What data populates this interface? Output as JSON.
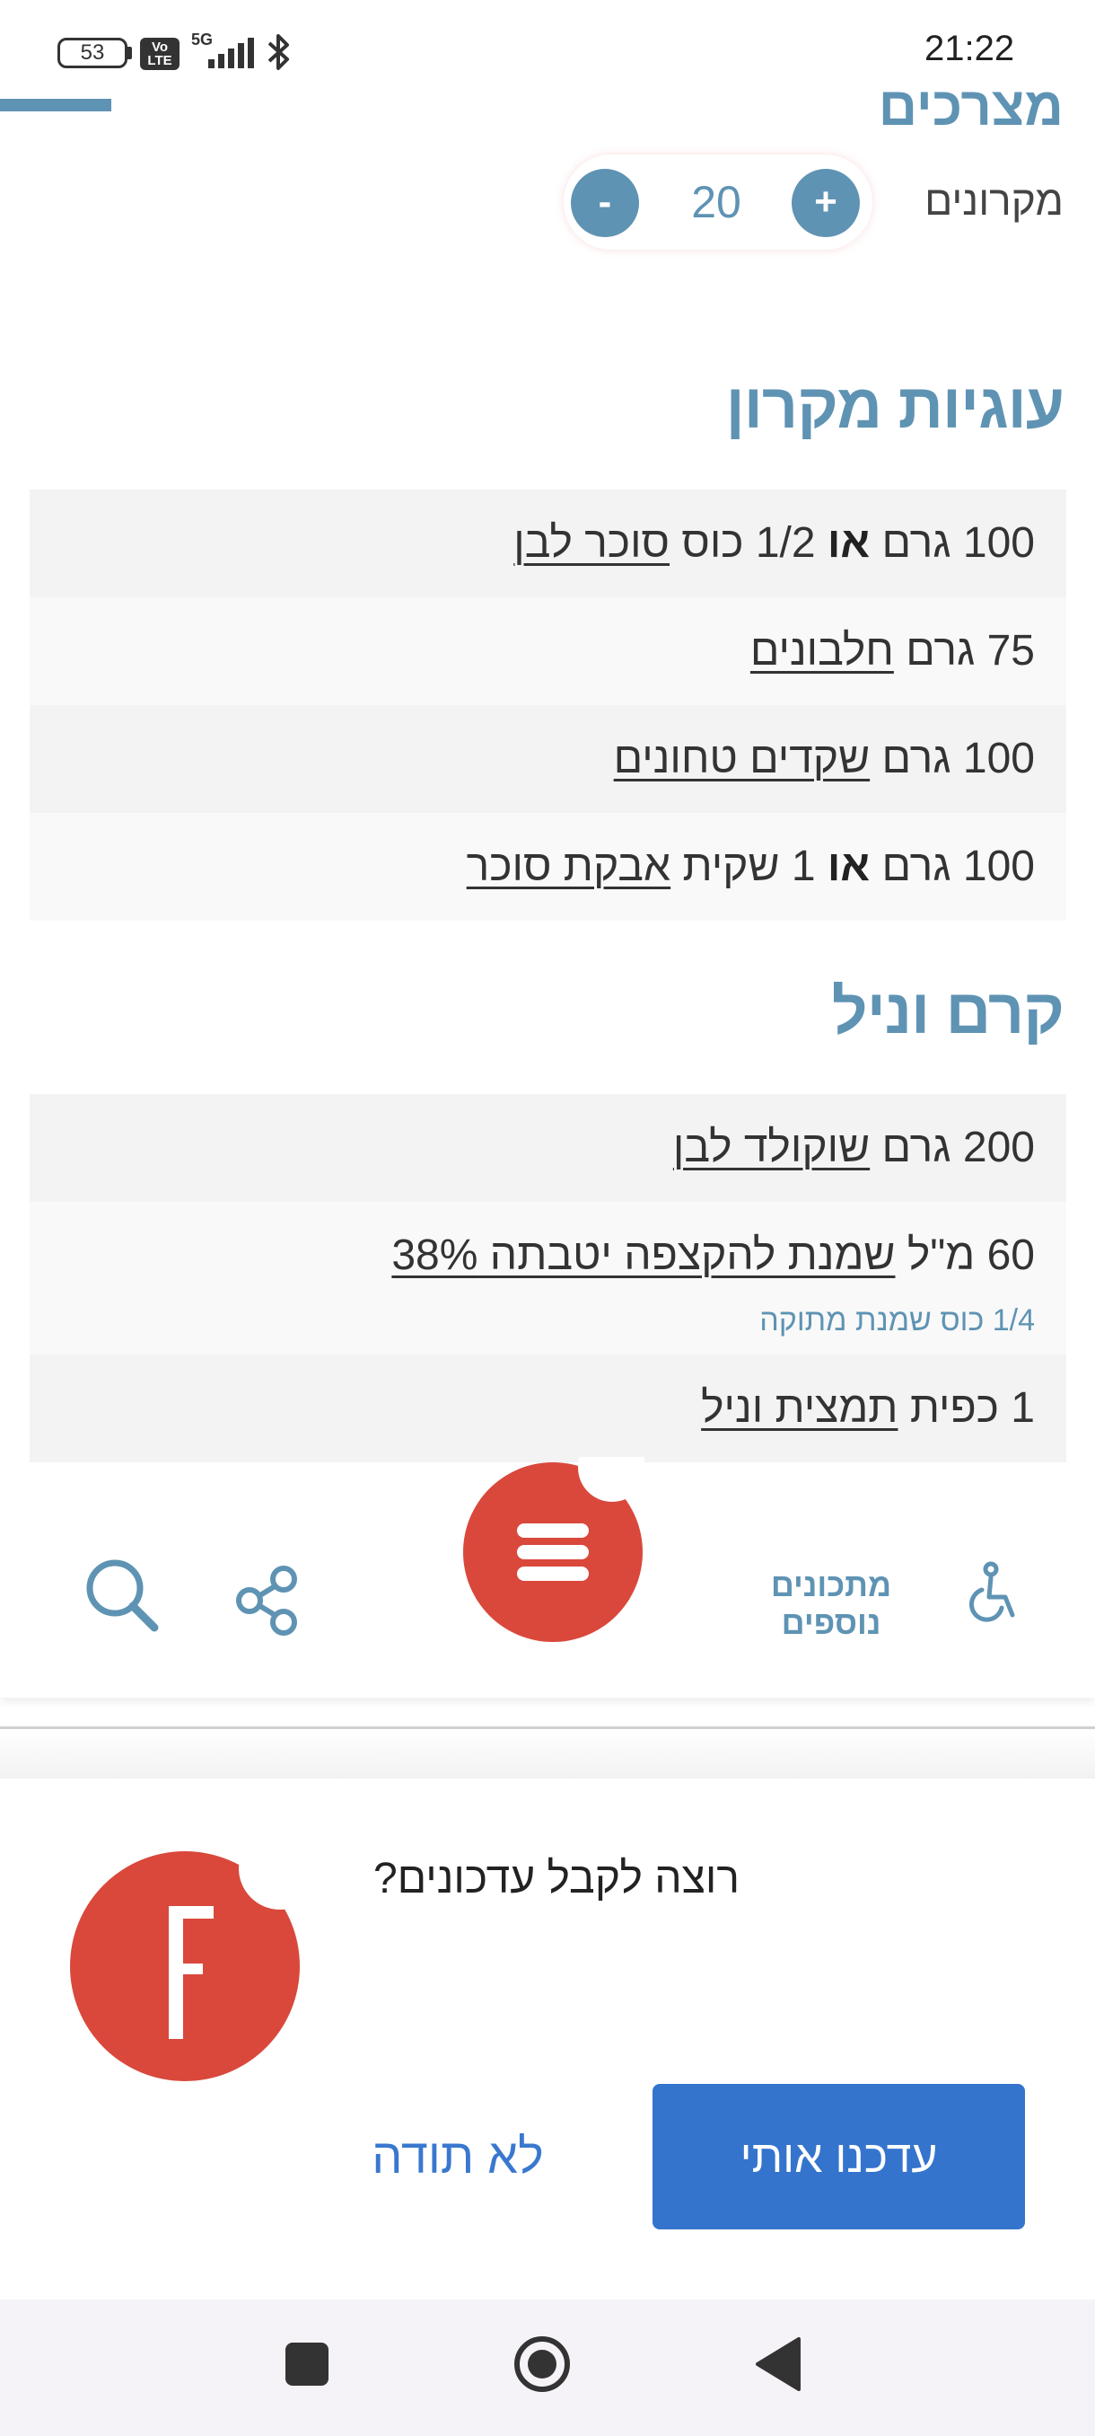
{
  "status_bar": {
    "time": "21:22",
    "battery": "53",
    "volte": "Vo LTE",
    "network": "5G"
  },
  "recipe": {
    "top_heading_partial": "מצרכים",
    "servings": {
      "count": "20",
      "unit_label": "מקרונים",
      "minus_label": "-",
      "plus_label": "+"
    },
    "sections": [
      {
        "title": "עוגיות מקרון",
        "rows": [
          {
            "qty": "100",
            "unit": "גרם",
            "or": "או",
            "alt_qty": "1/2",
            "alt_unit": "כוס",
            "item": "סוכר לבן"
          },
          {
            "qty": "75",
            "unit": "גרם",
            "item": "חלבונים"
          },
          {
            "qty": "100",
            "unit": "גרם",
            "item": "שקדים טחונים"
          },
          {
            "qty": "100",
            "unit": "גרם",
            "or": "או",
            "alt_qty": "1",
            "alt_unit": "שקית",
            "item": "אבקת סוכר"
          }
        ]
      },
      {
        "title": "קרם וניל",
        "rows": [
          {
            "qty": "200",
            "unit": "גרם",
            "item": "שוקולד לבן"
          },
          {
            "qty": "60",
            "unit": "מ\"ל",
            "item": "שמנת להקצפה יטבתה 38%",
            "note": "1/4 כוס שמנת מתוקה"
          },
          {
            "qty": "1",
            "unit": "כפית",
            "item": "תמצית וניל"
          }
        ]
      }
    ]
  },
  "app_bar": {
    "more_recipes_line1": "מתכונים",
    "more_recipes_line2": "נוספים"
  },
  "prompt": {
    "question": "רוצה לקבל עדכונים?",
    "accept": "עדכנו אותי",
    "decline": "לא תודה",
    "logo_letter": "F"
  },
  "colors": {
    "accent": "#5f93b3",
    "brand_red": "#d9483b",
    "button_blue": "#3474cd"
  }
}
